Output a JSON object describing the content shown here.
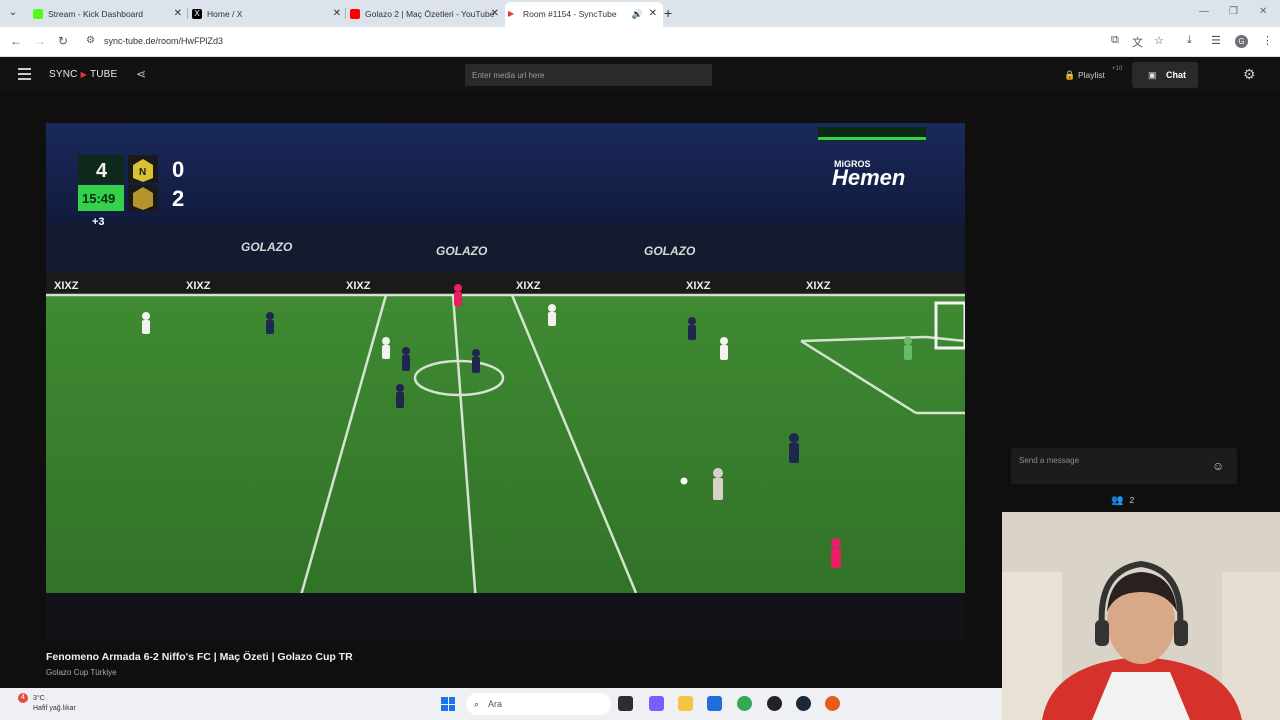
{
  "browser": {
    "tabs": [
      {
        "title": "Stream - Kick Dashboard",
        "favicon_color": "#53fc18",
        "active": false
      },
      {
        "title": "Home / X",
        "favicon_color": "#000000",
        "active": false
      },
      {
        "title": "Golazo 2 | Maç Özetleri - YouTube",
        "favicon_color": "#ff0000",
        "active": false
      },
      {
        "title": "Room #1154 - SyncTube",
        "favicon_color": "#e53935",
        "active": true
      }
    ],
    "url": "sync-tube.de/room/HwFPlZd3",
    "profile_initial": "G"
  },
  "app": {
    "logo_left": "SYNC",
    "logo_right": "TUBE",
    "media_placeholder": "Enter media url here",
    "playlist_label": "Playlist",
    "playlist_count": "+10",
    "chat_label": "Chat",
    "accent_color": "#e53935"
  },
  "video": {
    "title": "Fenomeno Armada 6-2 Niffo's FC | Maç Özeti | Golazo Cup TR",
    "channel": "Golazo Cup Türkiye",
    "scoreboard": {
      "home_score": "0",
      "away_score": "2",
      "clock": "15:49",
      "added_time": "+3",
      "home_badge": "N"
    },
    "sponsor_top": "MiGROS",
    "sponsor_main": "Hemen",
    "board_text": "GOLAZO",
    "ad_text": "XIXZ"
  },
  "chat": {
    "message_placeholder": "Send a message",
    "viewer_count": "2"
  },
  "taskbar": {
    "weather_temp": "3°C",
    "weather_desc": "Hafif yağ.lıkar",
    "weather_badge": "4",
    "search_label": "Ara"
  }
}
